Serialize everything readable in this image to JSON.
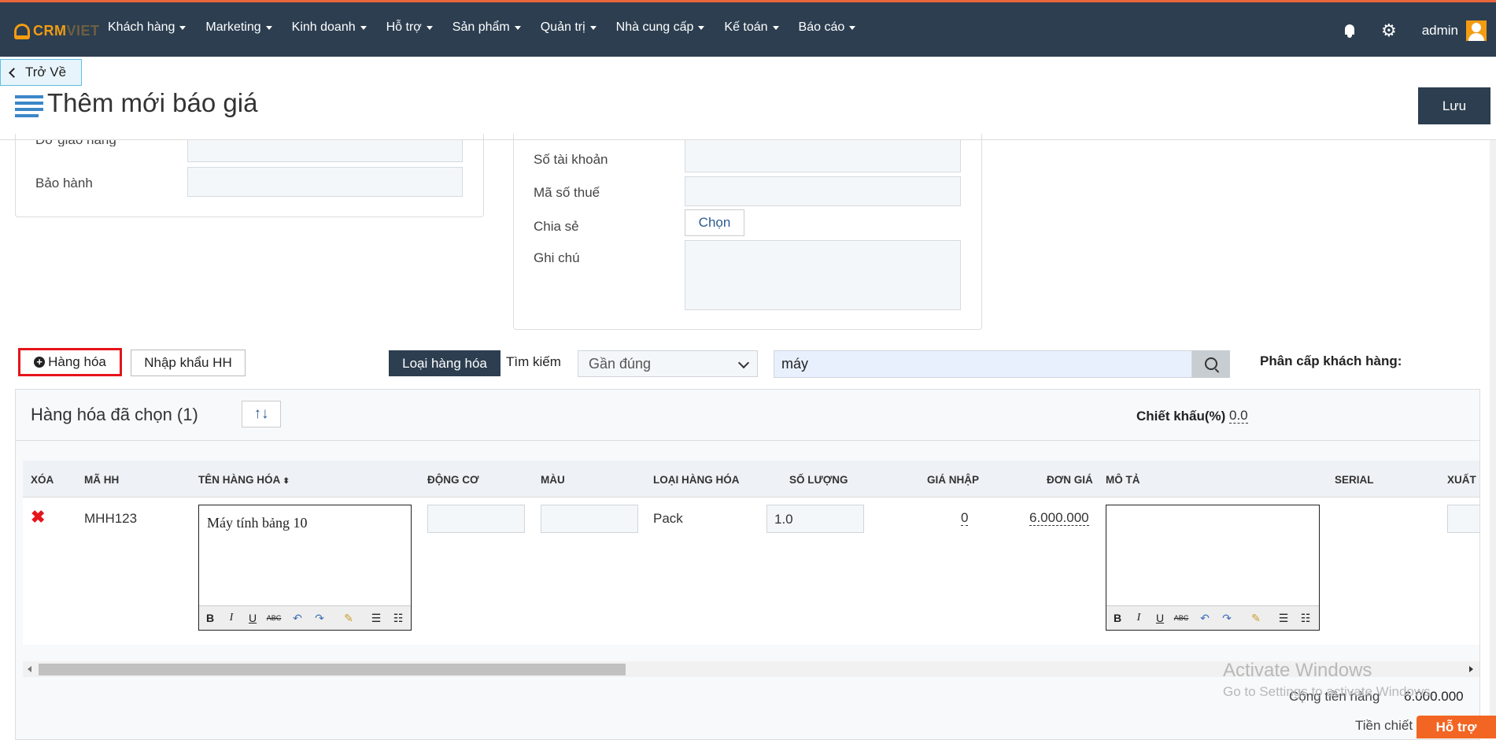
{
  "app": {
    "logo_a": "CRM",
    "logo_b": "VIET"
  },
  "nav": [
    "Khách hàng",
    "Marketing",
    "Kinh doanh",
    "Hỗ trợ",
    "Sản phẩm",
    "Quản trị",
    "Nhà cung cấp",
    "Kế toán",
    "Báo cáo"
  ],
  "user": {
    "name": "admin"
  },
  "header": {
    "back_label": "Trở Về",
    "title": "Thêm mới báo giá",
    "save_label": "Lưu"
  },
  "form_left": {
    "cut_label": "Đơ giao hàng",
    "warranty_label": "Bảo hành"
  },
  "form_right": {
    "account_label": "Số tài khoản",
    "tax_label": "Mã số thuế",
    "share_label": "Chia sẻ",
    "choose_label": "Chọn",
    "note_label": "Ghi chú"
  },
  "toolbar": {
    "add_goods": "Hàng hóa",
    "import_goods": "Nhập khẩu HH",
    "goods_type": "Loại hàng hóa",
    "search_label": "Tìm kiếm",
    "match_mode": "Gần đúng",
    "search_value": "máy",
    "tier_label": "Phân cấp khách hàng:"
  },
  "selected": {
    "title": "Hàng hóa đã chọn (1)",
    "sort_glyph": "↑↓",
    "discount_label": "Chiết khấu(%)",
    "discount_value": "0.0"
  },
  "table": {
    "headers": [
      "XÓA",
      "MÃ HH",
      "TÊN HÀNG HÓA",
      "ĐỘNG CƠ",
      "MÀU",
      "LOẠI HÀNG HÓA",
      "SỐ LƯỢNG",
      "GIÁ NHẬP",
      "ĐƠN GIÁ",
      "MÔ TẢ",
      "SERIAL",
      "XUẤT"
    ],
    "row": {
      "code": "MHH123",
      "name": "Máy tính bảng 10",
      "type": "Pack",
      "qty": "1.0",
      "import_price": "0",
      "unit_price": "6.000.000"
    }
  },
  "totals": {
    "subtotal_label": "Cộng tiền hàng",
    "subtotal_value": "6.000.000",
    "discount_label": "Tiền chiết"
  },
  "watermark": {
    "line1": "Activate Windows",
    "line2": "Go to Settings to activate Windows."
  },
  "support_label": "Hỗ trợ",
  "colors": {
    "nav_bg": "#2c3e50",
    "accent": "#f39c12",
    "highlight_border": "#e5151b",
    "support": "#f26522"
  }
}
